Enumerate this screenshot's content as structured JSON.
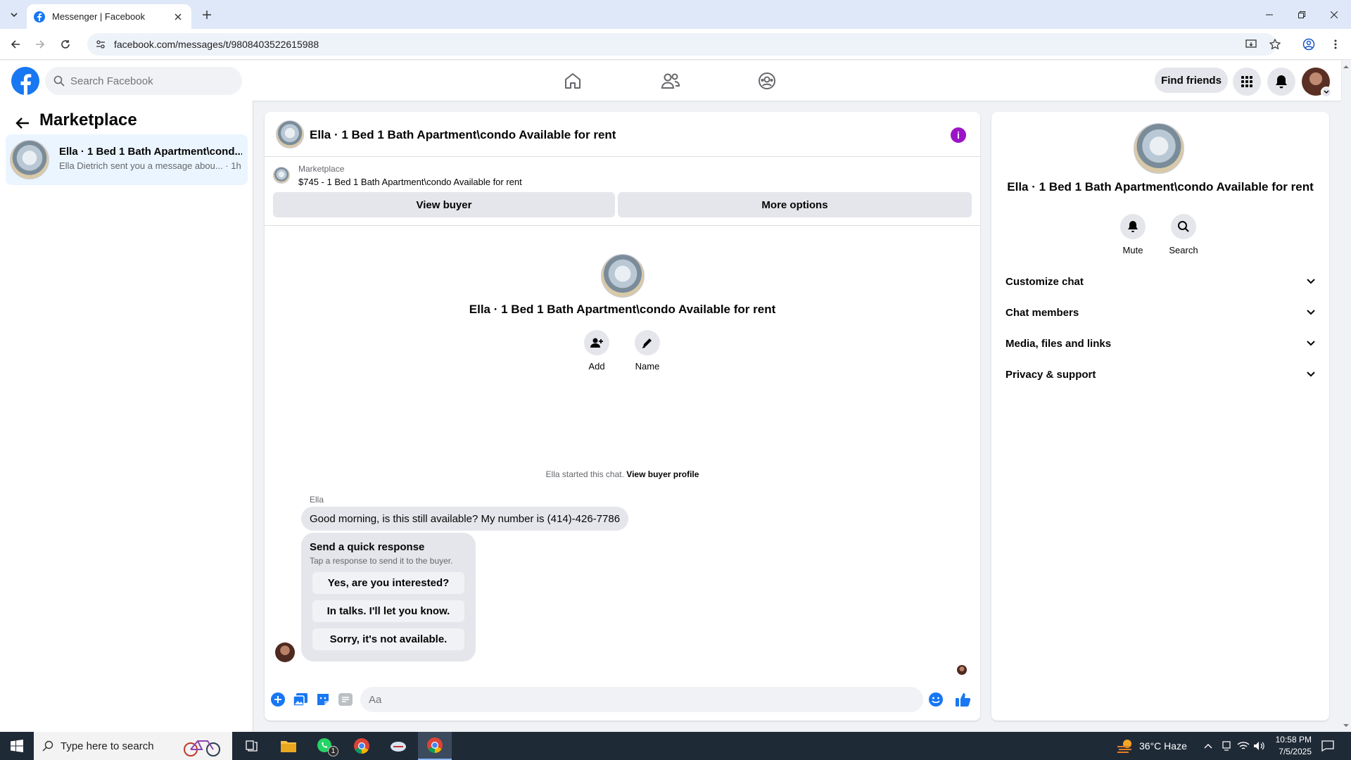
{
  "browser": {
    "tab_title": "Messenger | Facebook",
    "url": "facebook.com/messages/t/9808403522615988"
  },
  "fb_header": {
    "search_placeholder": "Search Facebook",
    "find_friends": "Find friends"
  },
  "left_panel": {
    "title": "Marketplace",
    "conversations": [
      {
        "name": "Ella · 1 Bed 1 Bath Apartment\\cond...",
        "preview": "Ella Dietrich sent you a message abou... · 1h"
      }
    ]
  },
  "chat": {
    "header_title": "Ella · 1 Bed 1 Bath Apartment\\condo Available for rent",
    "info_icon": "i",
    "marketplace_label": "Marketplace",
    "listing": "$745 - 1 Bed 1 Bath Apartment\\condo Available for rent",
    "view_buyer": "View buyer",
    "more_options": "More options",
    "intro_title": "Ella · 1 Bed 1 Bath Apartment\\condo Available for rent",
    "add_label": "Add",
    "name_label": "Name",
    "started_text": "Ella started this chat.",
    "view_buyer_profile": "View buyer profile",
    "sender_name": "Ella",
    "message": "Good morning, is this still available? My number is (414)-426-7786",
    "quick_response_title": "Send a quick response",
    "quick_response_sub": "Tap a response to send it to the buyer.",
    "quick_responses": [
      "Yes, are you interested?",
      "In talks. I'll let you know.",
      "Sorry, it's not available."
    ],
    "composer_placeholder": "Aa"
  },
  "right_panel": {
    "title": "Ella · 1 Bed 1 Bath Apartment\\condo Available for rent",
    "mute": "Mute",
    "search": "Search",
    "sections": [
      "Customize chat",
      "Chat members",
      "Media, files and links",
      "Privacy & support"
    ]
  },
  "taskbar": {
    "search_placeholder": "Type here to search",
    "weather": "36°C  Haze",
    "time": "10:58 PM",
    "date": "7/5/2025",
    "whatsapp_badge": "1"
  },
  "colors": {
    "fb_blue": "#1877f2",
    "active_conv_bg": "#ebf5ff",
    "info_purple": "#9b15c7",
    "taskbar_bg": "#1f2a37"
  }
}
